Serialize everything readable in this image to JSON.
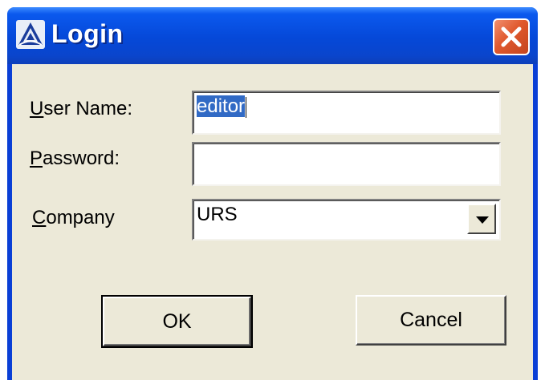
{
  "window": {
    "title": "Login",
    "icon": "app-logo-icon",
    "close_icon": "close-icon"
  },
  "form": {
    "username": {
      "label_accel": "U",
      "label_rest": "ser Name:",
      "value": "editor"
    },
    "password": {
      "label_accel": "P",
      "label_rest": "assword:",
      "value": ""
    },
    "company": {
      "label_accel": "C",
      "label_rest": "ompany",
      "value": "URS"
    }
  },
  "buttons": {
    "ok": "OK",
    "cancel": "Cancel"
  },
  "colors": {
    "title_bar": "#0548d8",
    "client_background": "#ece9d8",
    "selection": "#316ac5",
    "close_button": "#e0582d"
  }
}
